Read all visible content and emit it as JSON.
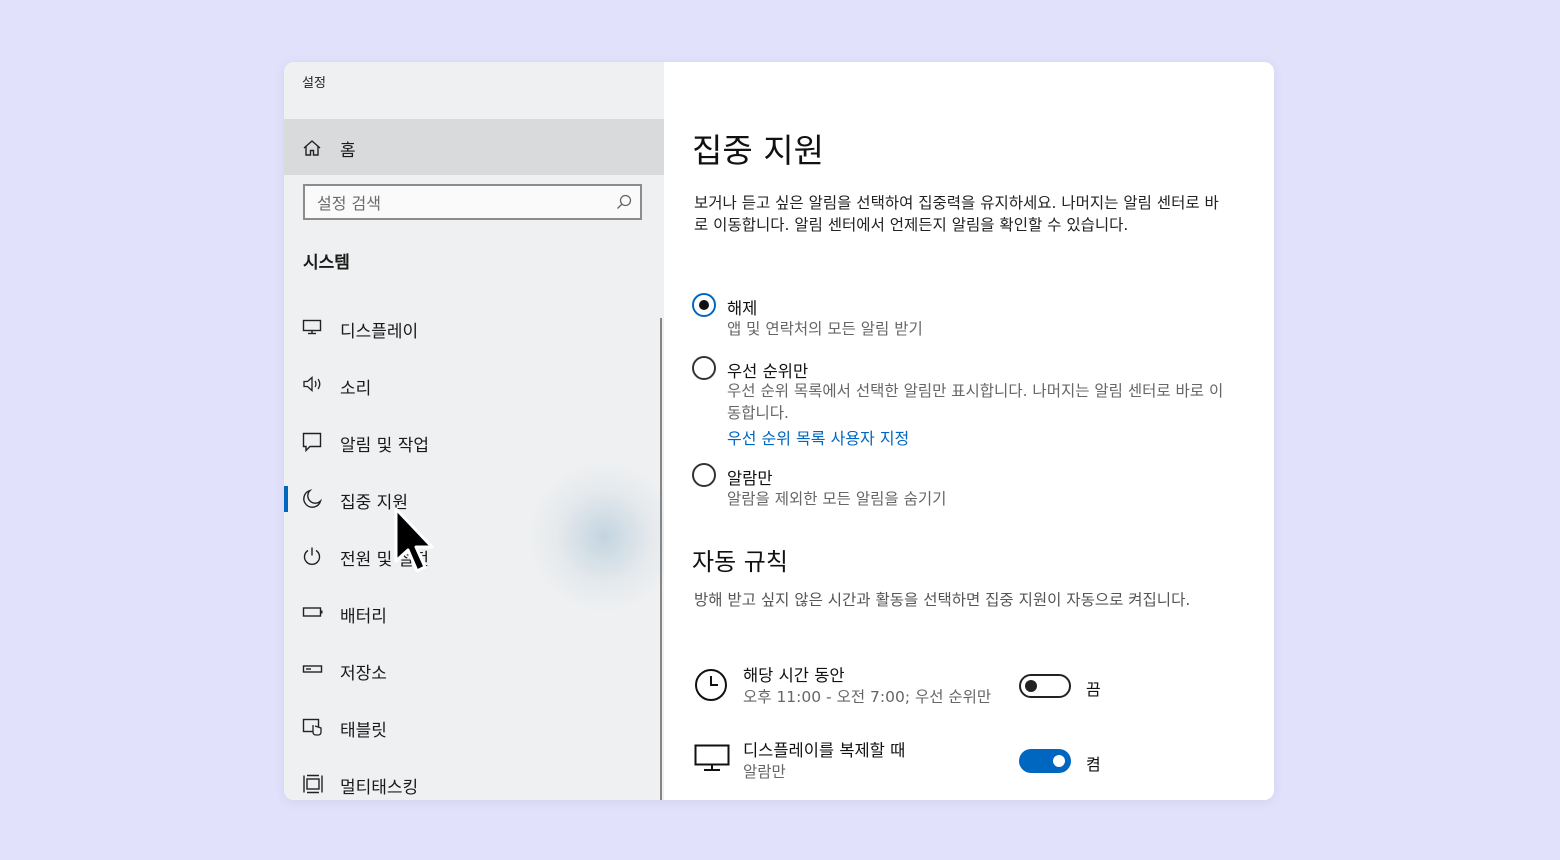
{
  "window": {
    "title": "설정"
  },
  "sidebar": {
    "home_label": "홈",
    "search_placeholder": "설정 검색",
    "section_title": "시스템",
    "items": [
      {
        "label": "디스플레이",
        "icon": "monitor-icon"
      },
      {
        "label": "소리",
        "icon": "speaker-icon"
      },
      {
        "label": "알림 및 작업",
        "icon": "notification-icon"
      },
      {
        "label": "집중 지원",
        "icon": "moon-icon",
        "active": true
      },
      {
        "label": "전원 및 절전",
        "icon": "power-icon"
      },
      {
        "label": "배터리",
        "icon": "battery-icon"
      },
      {
        "label": "저장소",
        "icon": "storage-icon"
      },
      {
        "label": "태블릿",
        "icon": "tablet-icon"
      },
      {
        "label": "멀티태스킹",
        "icon": "multitasking-icon"
      }
    ]
  },
  "main": {
    "title": "집중 지원",
    "description": "보거나 듣고 싶은 알림을 선택하여 집중력을 유지하세요. 나머지는 알림 센터로 바로 이동합니다. 알림 센터에서 언제든지 알림을 확인할 수 있습니다.",
    "options": [
      {
        "title": "해제",
        "sub": "앱 및 연락처의 모든 알림 받기",
        "selected": true
      },
      {
        "title": "우선 순위만",
        "sub": "우선 순위 목록에서 선택한 알림만 표시합니다. 나머지는 알림 센터로 바로 이동합니다.",
        "link": "우선 순위 목록 사용자 지정",
        "selected": false
      },
      {
        "title": "알람만",
        "sub": "알람을 제외한 모든 알림을 숨기기",
        "selected": false
      }
    ],
    "auto_rules": {
      "title": "자동 규칙",
      "description": "방해 받고 싶지 않은 시간과 활동을 선택하면 집중 지원이 자동으로 켜집니다.",
      "rules": [
        {
          "title": "해당 시간 동안",
          "sub": "오후 11:00 - 오전 7:00; 우선 순위만",
          "toggle_label": "끔",
          "on": false,
          "icon": "clock-icon"
        },
        {
          "title": "디스플레이를 복제할 때",
          "sub": "알람만",
          "toggle_label": "켬",
          "on": true,
          "icon": "monitor-icon"
        }
      ]
    }
  },
  "colors": {
    "accent": "#0067c0",
    "background": "#e1e1fb",
    "sidebar": "#eff0f1"
  }
}
